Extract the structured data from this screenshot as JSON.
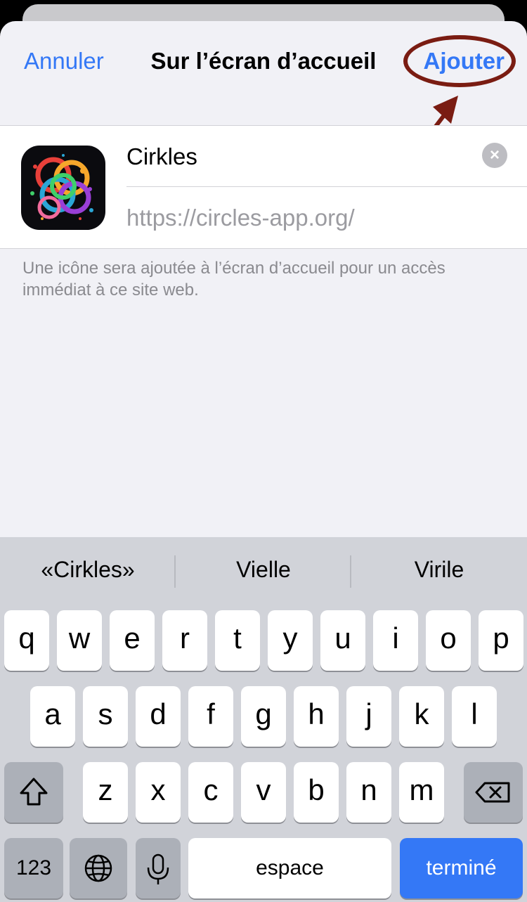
{
  "header": {
    "cancel_label": "Annuler",
    "title": "Sur l’écran d’accueil",
    "add_label": "Ajouter"
  },
  "bookmark": {
    "name": "Cirkles",
    "url": "https://circles-app.org/",
    "clear_icon": "clear-circle-icon"
  },
  "footer_note": "Une icône sera ajoutée à l’écran d’accueil pour un accès immédiat à ce site web.",
  "keyboard": {
    "suggestions": [
      "«Cirkles»",
      "Vielle",
      "Virile"
    ],
    "row1": [
      "q",
      "w",
      "e",
      "r",
      "t",
      "y",
      "u",
      "i",
      "o",
      "p"
    ],
    "row2": [
      "a",
      "s",
      "d",
      "f",
      "g",
      "h",
      "j",
      "k",
      "l"
    ],
    "row3": [
      "z",
      "x",
      "c",
      "v",
      "b",
      "n",
      "m"
    ],
    "numbers_label": "123",
    "space_label": "espace",
    "done_label": "terminé",
    "icons": {
      "shift": "shift-icon",
      "delete": "backspace-icon",
      "globe": "globe-icon",
      "mic": "microphone-icon"
    }
  },
  "colors": {
    "accent": "#3478f6",
    "annotation": "#7a1c12",
    "sheet_background": "#f1f1f6",
    "keyboard_background": "#d1d3d9"
  }
}
